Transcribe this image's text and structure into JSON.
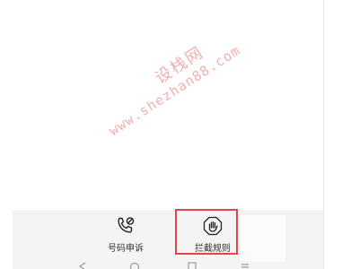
{
  "watermark": {
    "cn": "设栈网",
    "en": "www.shezhan88.com"
  },
  "toolbar": {
    "items": [
      {
        "label": "号码申诉",
        "icon": "phone-blocked-icon"
      },
      {
        "label": "拦截规则",
        "icon": "hand-stop-icon"
      }
    ]
  },
  "navbar": {
    "buttons": [
      "back-icon",
      "home-icon",
      "recents-icon",
      "menu-icon"
    ]
  },
  "colors": {
    "highlight": "#e0474c",
    "toolbar_bg": "#f4f4f4",
    "watermark": "#e86e6e"
  }
}
